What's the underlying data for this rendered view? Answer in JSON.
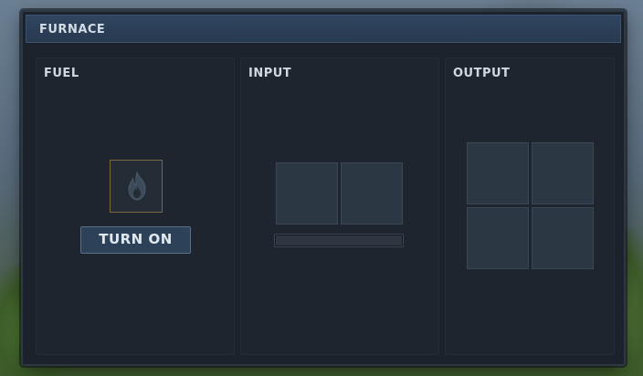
{
  "window": {
    "title": "FURNACE"
  },
  "panels": {
    "fuel": {
      "label": "FUEL",
      "slot_icon": "fire-icon",
      "button_label": "TURN ON"
    },
    "input": {
      "label": "INPUT",
      "slot_count": 2,
      "progress": 0
    },
    "output": {
      "label": "OUTPUT",
      "slot_count": 4
    }
  },
  "colors": {
    "title_bar": "#2f4560",
    "panel_bg": "#1e252e",
    "slot_bg": "#2b3743",
    "fuel_slot_border": "#7a6844",
    "button_bg": "#2d4159",
    "text": "#d5dde6"
  }
}
